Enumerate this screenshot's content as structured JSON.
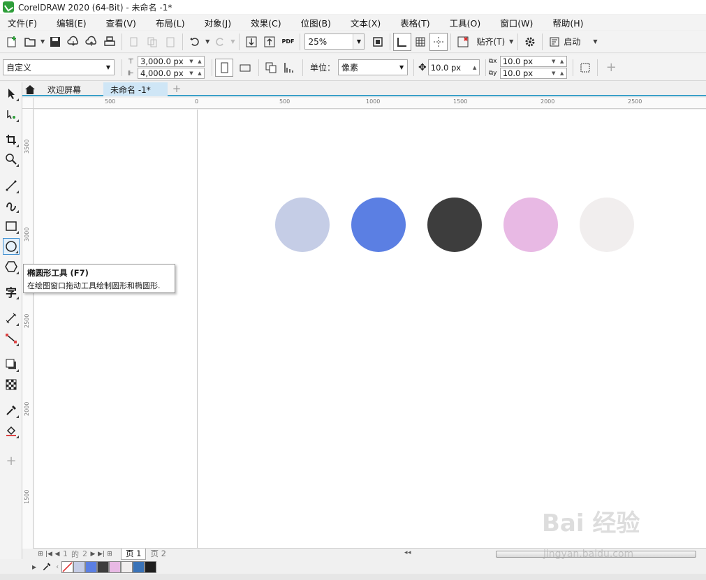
{
  "window": {
    "title": "CorelDRAW 2020 (64-Bit) - 未命名 -1*"
  },
  "menu": [
    "文件(F)",
    "编辑(E)",
    "查看(V)",
    "布局(L)",
    "对象(J)",
    "效果(C)",
    "位图(B)",
    "文本(X)",
    "表格(T)",
    "工具(O)",
    "窗口(W)",
    "帮助(H)"
  ],
  "toolbar": {
    "zoom": "25%",
    "snap_label": "贴齐(T)",
    "launch_label": "启动",
    "pdf_label": "PDF"
  },
  "propbar": {
    "preset": "自定义",
    "width": "3,000.0 px",
    "height": "4,000.0 px",
    "unit_label": "单位：",
    "unit": "像素",
    "nudge": "10.0 px",
    "dup_x": "10.0 px",
    "dup_y": "10.0 px"
  },
  "tabs": {
    "welcome": "欢迎屏幕",
    "doc": "未命名 -1*"
  },
  "ruler": {
    "h": [
      "500",
      "0",
      "500",
      "1000",
      "1500",
      "2000",
      "2500"
    ],
    "v": [
      "3500",
      "3000",
      "2500",
      "2000",
      "1500"
    ]
  },
  "circles": [
    {
      "name": "circle-light-blue",
      "color": "#c5cde6"
    },
    {
      "name": "circle-blue",
      "color": "#5b7fe3"
    },
    {
      "name": "circle-dark-gray",
      "color": "#3d3d3d"
    },
    {
      "name": "circle-pink",
      "color": "#e8b9e4"
    },
    {
      "name": "circle-off-white",
      "color": "#f1eeee"
    }
  ],
  "tooltip": {
    "title": "椭圆形工具 (F7)",
    "desc": "在绘图窗口拖动工具绘制圆形和椭圆形."
  },
  "pagenav": {
    "current": "1",
    "of": "的",
    "total": "2",
    "page1": "页 1",
    "page2": "页 2"
  },
  "palette": [
    "#c5cde6",
    "#5b7fe3",
    "#3d3d3d",
    "#e8b9e4",
    "#f1eeee",
    "#3a73b8",
    "#1f1f1f"
  ],
  "watermark": {
    "main": "Bai 经验",
    "sub": "jingyan.baidu.com"
  }
}
